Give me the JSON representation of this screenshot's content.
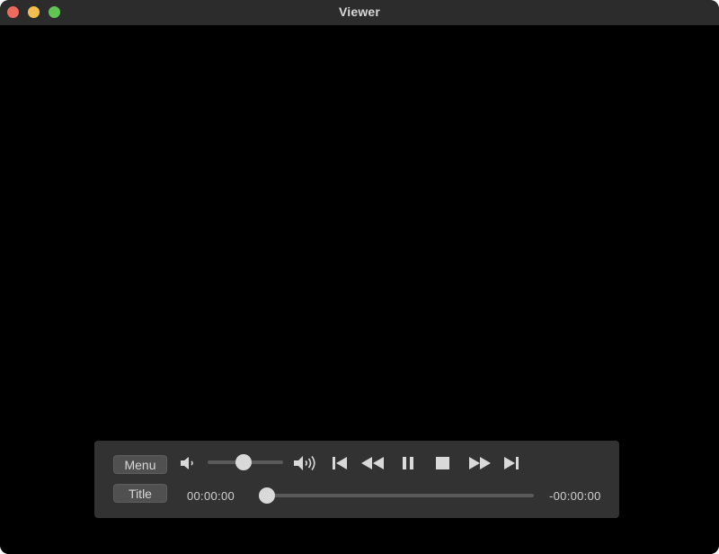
{
  "window": {
    "title": "Viewer",
    "traffic_lights": {
      "close": "#ed6a5e",
      "minimize": "#f5bf4f",
      "zoom": "#61c554"
    }
  },
  "controller": {
    "menu_label": "Menu",
    "title_label": "Title",
    "volume": {
      "low_icon": "speaker-low-icon",
      "high_icon": "speaker-high-icon",
      "level_fraction": 0.48
    },
    "transport": [
      {
        "name": "skip-back",
        "icon": "skip-to-start-icon"
      },
      {
        "name": "rewind",
        "icon": "rewind-icon"
      },
      {
        "name": "pause",
        "icon": "pause-icon"
      },
      {
        "name": "stop",
        "icon": "stop-icon"
      },
      {
        "name": "fast-forward",
        "icon": "fast-forward-icon"
      },
      {
        "name": "skip-forward",
        "icon": "skip-to-end-icon"
      }
    ],
    "elapsed_time": "00:00:00",
    "remaining_time": "-00:00:00",
    "progress_fraction": 0.0
  }
}
